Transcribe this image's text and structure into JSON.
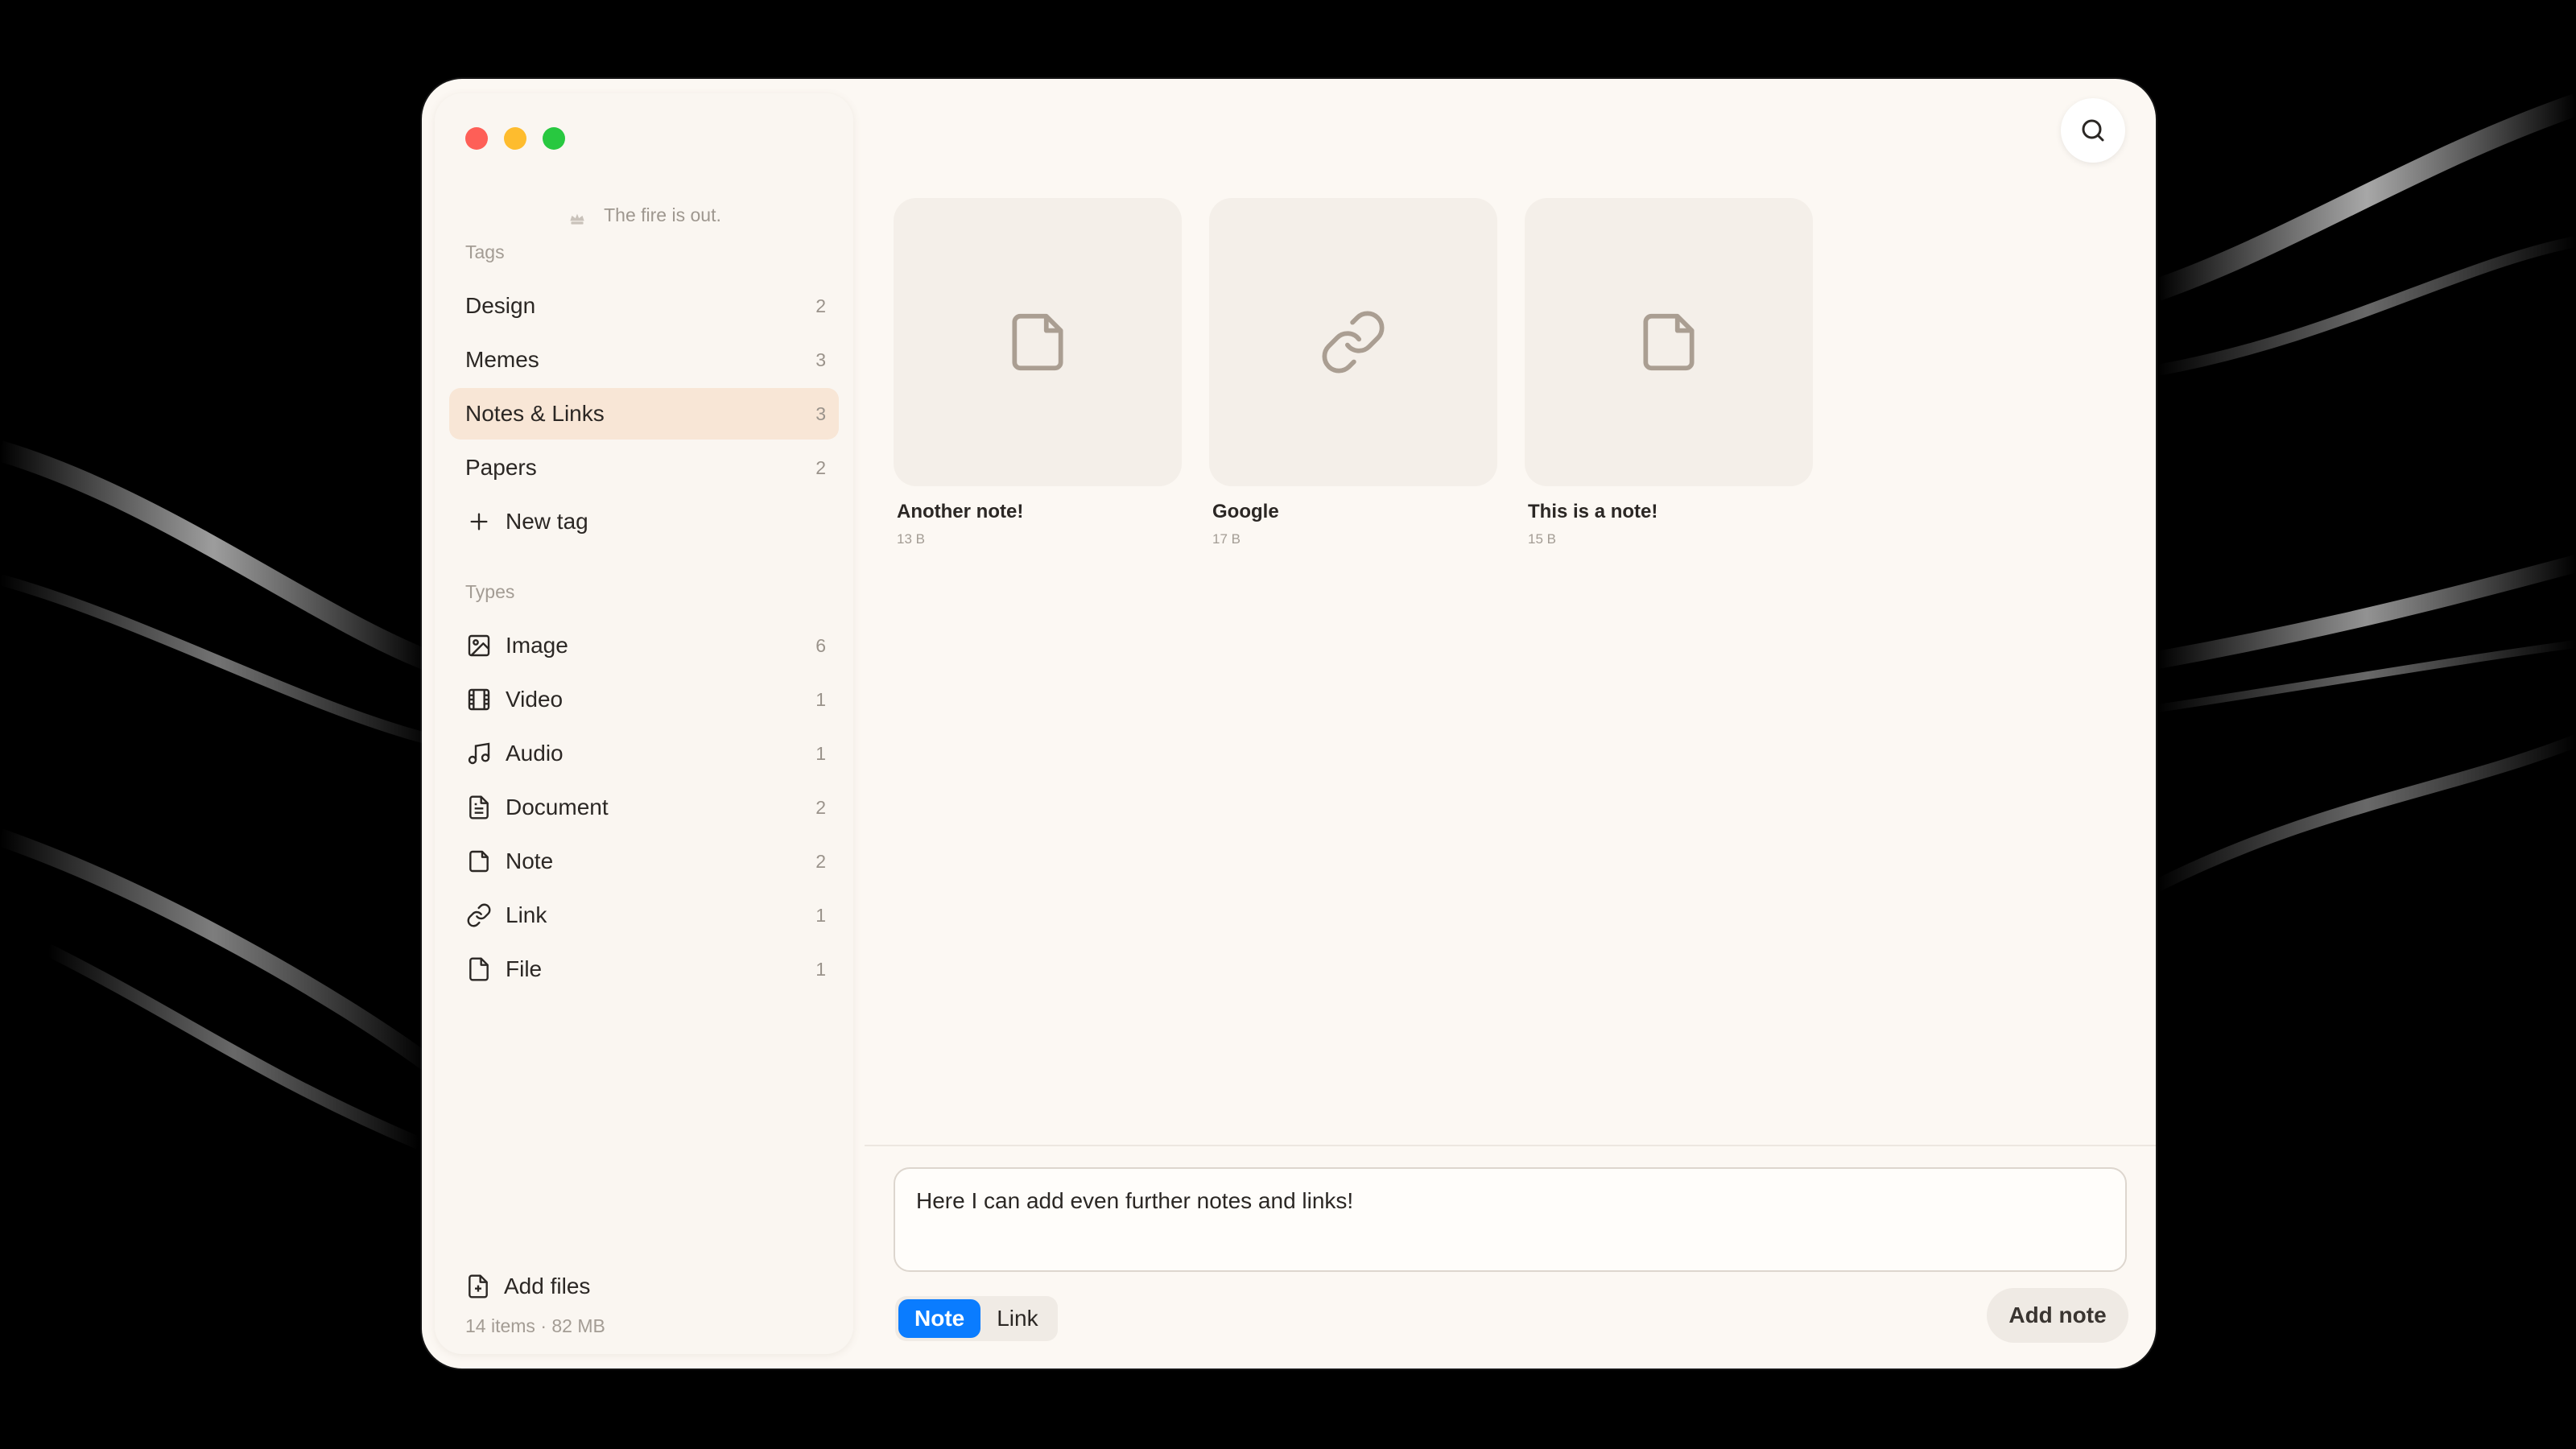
{
  "status": {
    "fire_text": "The fire is out."
  },
  "sidebar": {
    "tags_label": "Tags",
    "tags": [
      {
        "label": "Design",
        "count": "2"
      },
      {
        "label": "Memes",
        "count": "3"
      },
      {
        "label": "Notes & Links",
        "count": "3",
        "active": true
      },
      {
        "label": "Papers",
        "count": "2"
      }
    ],
    "new_tag_label": "New tag",
    "types_label": "Types",
    "types": [
      {
        "label": "Image",
        "count": "6",
        "icon": "image-icon"
      },
      {
        "label": "Video",
        "count": "1",
        "icon": "video-icon"
      },
      {
        "label": "Audio",
        "count": "1",
        "icon": "audio-icon"
      },
      {
        "label": "Document",
        "count": "2",
        "icon": "document-icon"
      },
      {
        "label": "Note",
        "count": "2",
        "icon": "note-icon"
      },
      {
        "label": "Link",
        "count": "1",
        "icon": "link-icon"
      },
      {
        "label": "File",
        "count": "1",
        "icon": "file-icon"
      }
    ],
    "add_files_label": "Add files",
    "stats": "14 items · 82 MB"
  },
  "main": {
    "cards": [
      {
        "title": "Another note!",
        "size": "13 B",
        "icon": "note-icon"
      },
      {
        "title": "Google",
        "size": "17 B",
        "icon": "link-icon"
      },
      {
        "title": "This is a note!",
        "size": "15 B",
        "icon": "note-icon"
      }
    ]
  },
  "composer": {
    "text": "Here I can add even further notes and links!",
    "mode_note": "Note",
    "mode_link": "Link",
    "selected_mode": "Note",
    "submit_label": "Add note"
  },
  "colors": {
    "accent": "#0a7cff",
    "active_tag_bg": "#f8e6d6",
    "window_bg": "#fcf8f3"
  }
}
